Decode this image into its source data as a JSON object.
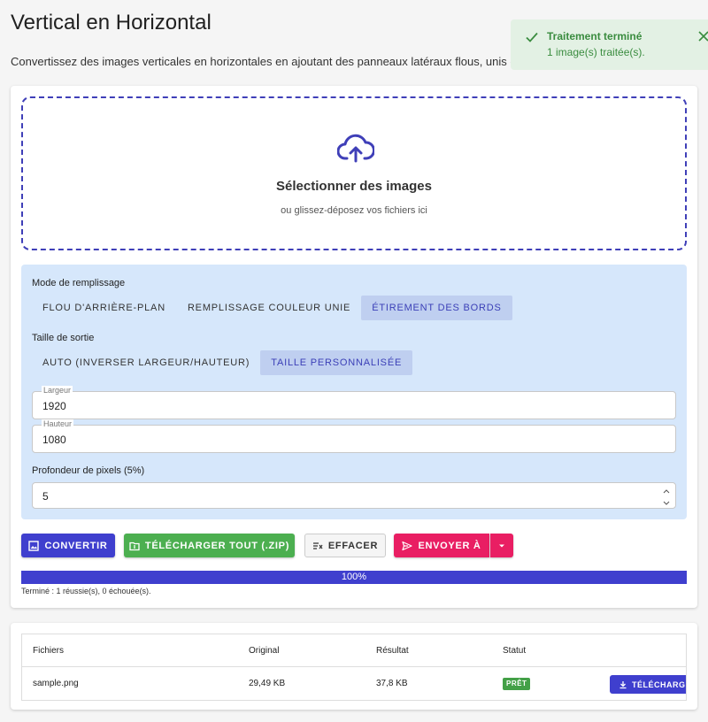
{
  "header": {
    "title": "Vertical en Horizontal",
    "subtitle": "Convertissez des images verticales en horizontales en ajoutant des panneaux latéraux flous, unis ou"
  },
  "toast": {
    "title": "Traitement terminé",
    "message": "1 image(s) traitée(s).",
    "color": "#3a8c3f",
    "icons": [
      "check-icon",
      "close-icon"
    ]
  },
  "dropzone": {
    "title": "Sélectionner des images",
    "subtitle": "ou glissez-déposez vos fichiers ici",
    "icon": "cloud-upload-icon"
  },
  "settings": {
    "fill_mode_label": "Mode de remplissage",
    "fill_modes": [
      "Flou d'arrière-plan",
      "Remplissage couleur unie",
      "Étirement des bords"
    ],
    "fill_mode_selected": "Étirement des bords",
    "output_size_label": "Taille de sortie",
    "output_sizes": [
      "Auto (inverser largeur/hauteur)",
      "Taille personnalisée"
    ],
    "output_size_selected": "Taille personnalisée",
    "width_label": "Largeur",
    "width_value": "1920",
    "height_label": "Hauteur",
    "height_value": "1080",
    "depth_label": "Profondeur de pixels (5%)",
    "depth_value": "5"
  },
  "actions": {
    "convert": "Convertir",
    "download_all": "Télécharger tout (.zip)",
    "clear": "Effacer",
    "send_to": "Envoyer à"
  },
  "progress": {
    "value": 100,
    "label": "100%",
    "status": "Terminé : 1 réussie(s), 0 échouée(s)."
  },
  "results": {
    "columns": [
      "Fichiers",
      "Original",
      "Résultat",
      "Statut"
    ],
    "rows": [
      {
        "file": "sample.png",
        "original": "29,49 KB",
        "result": "37,8 KB",
        "status": "PRÊT",
        "action": "Télécharger"
      }
    ]
  },
  "colors": {
    "primary": "#3f3fce",
    "success": "#4caf50",
    "pink": "#e91e63",
    "panel": "#d6e7fb"
  }
}
